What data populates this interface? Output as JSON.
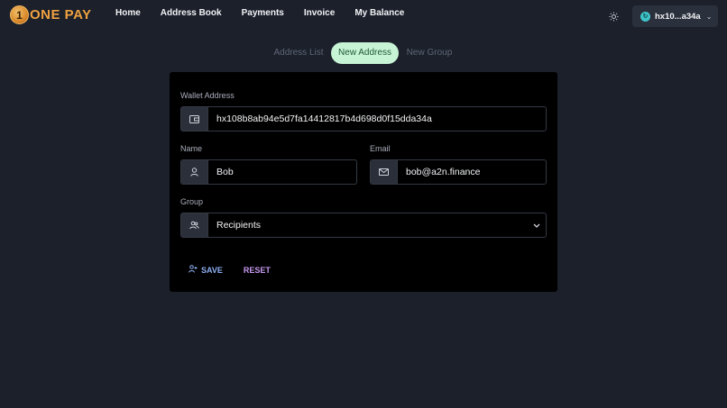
{
  "app": {
    "logo_text": "ONE PAY",
    "logo_coin": "1"
  },
  "nav": {
    "items": [
      "Home",
      "Address Book",
      "Payments",
      "Invoice",
      "My Balance"
    ]
  },
  "header": {
    "theme_icon": "sun-icon",
    "wallet_label": "hx10...a34a",
    "wallet_icon": "wallet-status-icon",
    "wallet_chevron": "chevron-down-icon"
  },
  "tabs": [
    {
      "label": "Address List",
      "active": false
    },
    {
      "label": "New Address",
      "active": true
    },
    {
      "label": "New Group",
      "active": false
    }
  ],
  "form": {
    "wallet_address": {
      "label": "Wallet Address",
      "value": "hx108b8ab94e5d7fa14412817b4d698d0f15dda34a",
      "icon": "wallet-icon"
    },
    "name": {
      "label": "Name",
      "value": "Bob",
      "icon": "user-icon"
    },
    "email": {
      "label": "Email",
      "value": "bob@a2n.finance",
      "icon": "mail-icon"
    },
    "group": {
      "label": "Group",
      "value": "Recipients",
      "icon": "group-icon"
    },
    "save_label": "SAVE",
    "reset_label": "RESET"
  },
  "colors": {
    "background": "#1b202b",
    "card": "#000000",
    "active_tab_bg": "#c8f4d6",
    "active_tab_text": "#1f5a34",
    "save": "#8fb0f5",
    "reset": "#c79af2",
    "logo": "#f0a240"
  }
}
